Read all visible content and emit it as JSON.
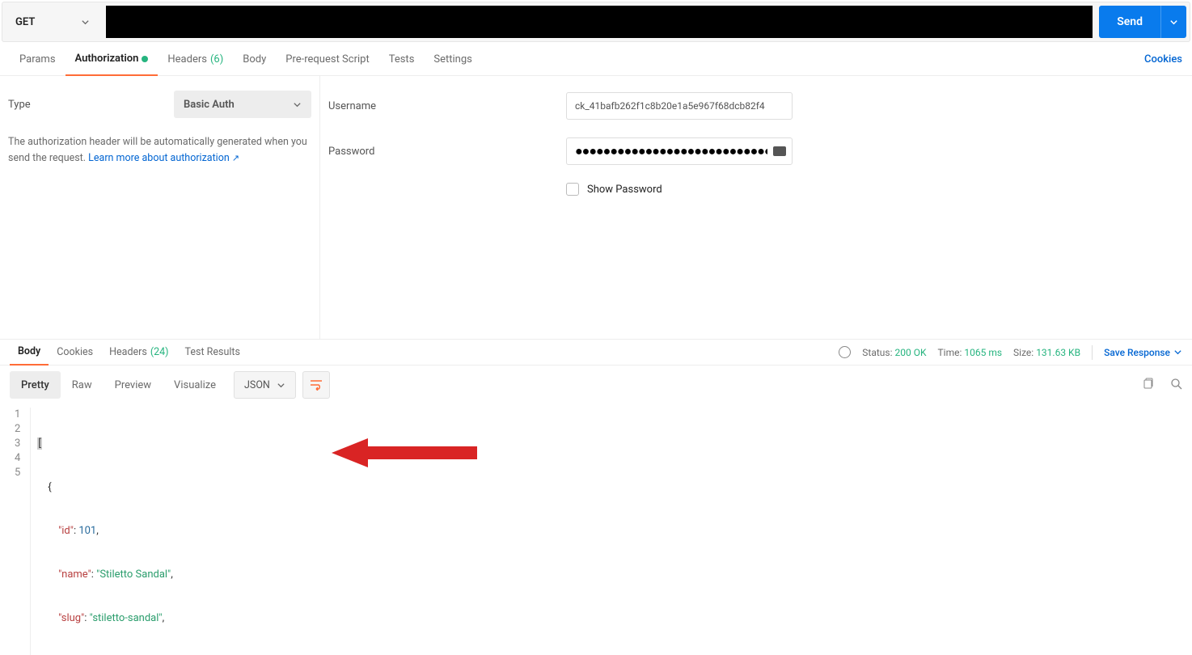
{
  "request": {
    "method": "GET",
    "url": "",
    "send_label": "Send"
  },
  "tabs": {
    "params": "Params",
    "authorization": "Authorization",
    "headers": "Headers",
    "headers_count": "(6)",
    "body": "Body",
    "prerequest": "Pre-request Script",
    "tests": "Tests",
    "settings": "Settings",
    "cookies": "Cookies"
  },
  "auth": {
    "type_label": "Type",
    "type_value": "Basic Auth",
    "help_text": "The authorization header will be automatically generated when you send the request. ",
    "learn_more": "Learn more about authorization",
    "username_label": "Username",
    "username_value": "ck_41bafb262f1c8b20e1a5e967f68dcb82f4",
    "password_label": "Password",
    "password_value": "●●●●●●●●●●●●●●●●●●●●●●●●●●●●●●●●●●●●●●●",
    "show_password": "Show Password"
  },
  "response_tabs": {
    "body": "Body",
    "cookies": "Cookies",
    "headers": "Headers",
    "headers_count": "(24)",
    "tests": "Test Results"
  },
  "response_meta": {
    "status_label": "Status:",
    "status_value": "200 OK",
    "time_label": "Time:",
    "time_value": "1065 ms",
    "size_label": "Size:",
    "size_value": "131.63 KB",
    "save": "Save Response"
  },
  "view_modes": {
    "pretty": "Pretty",
    "raw": "Raw",
    "preview": "Preview",
    "visualize": "Visualize",
    "format": "JSON"
  },
  "code_lines": {
    "l1": "[",
    "l2_indent": "    ",
    "l2": "{",
    "l3_indent": "        ",
    "l3_key": "\"id\"",
    "l3_sep": ": ",
    "l3_val": "101",
    "l3_end": ",",
    "l4_key": "\"name\"",
    "l4_val": "\"Stiletto Sandal\"",
    "l5_key": "\"slug\"",
    "l5_val": "\"stiletto-sandal\""
  }
}
